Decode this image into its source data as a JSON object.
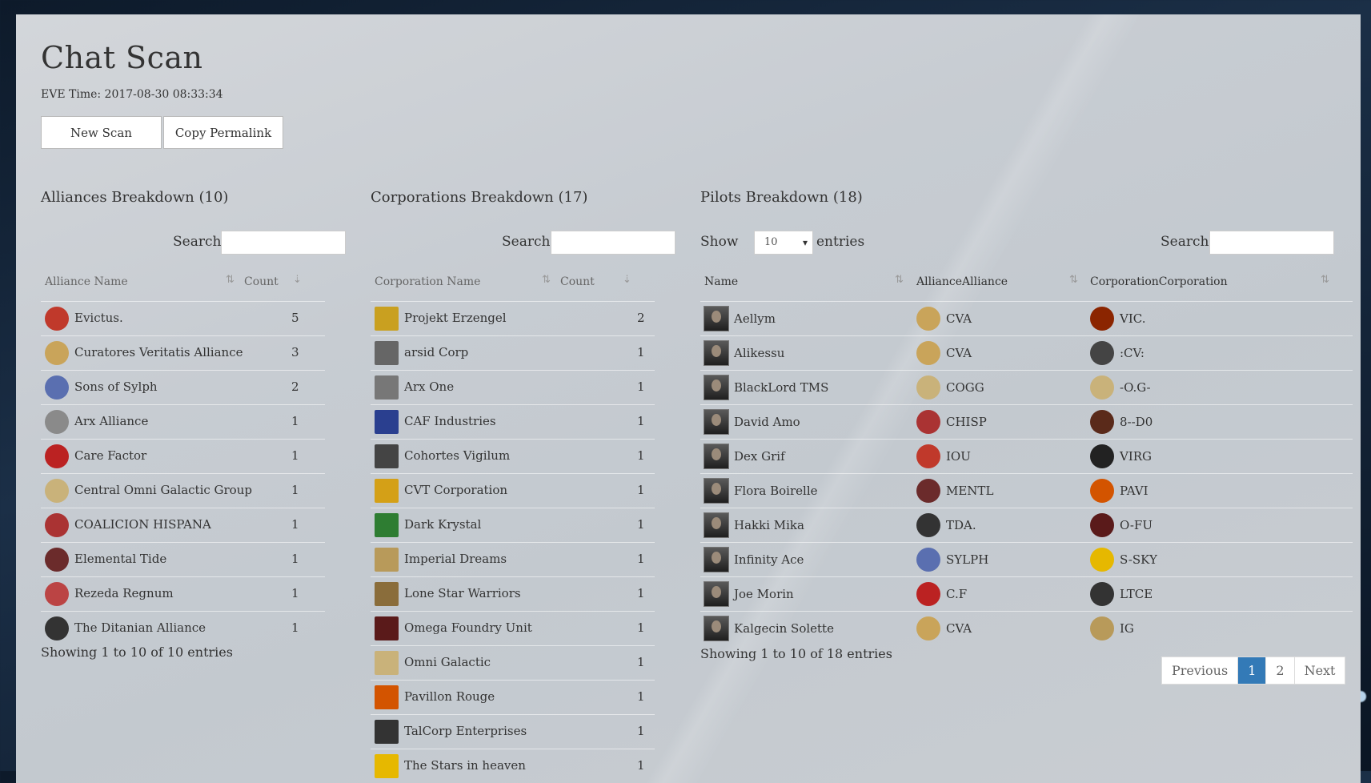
{
  "page": {
    "title": "Chat Scan",
    "eve_time": "EVE Time: 2017-08-30 08:33:34",
    "buttons": {
      "new_scan": "New Scan",
      "copy_permalink": "Copy Permalink"
    }
  },
  "alliances": {
    "title": "Alliances Breakdown (10)",
    "search_label": "Search:",
    "col_name": "Alliance Name",
    "col_count": "Count",
    "rows": [
      {
        "name": "Evictus.",
        "count": "5",
        "icon": "evictus-logo",
        "color": "#c0392b"
      },
      {
        "name": "Curatores Veritatis Alliance",
        "count": "3",
        "icon": "cva-logo",
        "color": "#c9a45a"
      },
      {
        "name": "Sons of Sylph",
        "count": "2",
        "icon": "sylph-logo",
        "color": "#5a6fb0"
      },
      {
        "name": "Arx Alliance",
        "count": "1",
        "icon": "arx-logo",
        "color": "#8a8a8a"
      },
      {
        "name": "Care Factor",
        "count": "1",
        "icon": "care-factor-logo",
        "color": "#b22"
      },
      {
        "name": "Central Omni Galactic Group",
        "count": "1",
        "icon": "cogg-logo",
        "color": "#c9b27a"
      },
      {
        "name": "COALICION HISPANA",
        "count": "1",
        "icon": "chisp-logo",
        "color": "#a33"
      },
      {
        "name": "Elemental Tide",
        "count": "1",
        "icon": "elemental-tide-logo",
        "color": "#6b2b2b"
      },
      {
        "name": "Rezeda Regnum",
        "count": "1",
        "icon": "rezeda-logo",
        "color": "#b44"
      },
      {
        "name": "The Ditanian Alliance",
        "count": "1",
        "icon": "tda-logo",
        "color": "#333"
      }
    ],
    "footer": "Showing 1 to 10 of 10 entries"
  },
  "corporations": {
    "title": "Corporations Breakdown (17)",
    "search_label": "Search:",
    "col_name": "Corporation Name",
    "col_count": "Count",
    "rows": [
      {
        "name": "Projekt Erzengel",
        "count": "2",
        "icon": "erzengel-logo",
        "color": "#c9a020"
      },
      {
        "name": "arsid Corp",
        "count": "1",
        "icon": "arsid-logo",
        "color": "#666"
      },
      {
        "name": "Arx One",
        "count": "1",
        "icon": "arx-one-logo",
        "color": "#777"
      },
      {
        "name": "CAF Industries",
        "count": "1",
        "icon": "caf-logo",
        "color": "#2a3f8f"
      },
      {
        "name": "Cohortes Vigilum",
        "count": "1",
        "icon": "cohortes-logo",
        "color": "#444"
      },
      {
        "name": "CVT Corporation",
        "count": "1",
        "icon": "cvt-logo",
        "color": "#d4a017"
      },
      {
        "name": "Dark Krystal",
        "count": "1",
        "icon": "dark-krystal-logo",
        "color": "#2e7d32"
      },
      {
        "name": "Imperial Dreams",
        "count": "1",
        "icon": "imperial-dreams-logo",
        "color": "#b89a5a"
      },
      {
        "name": "Lone Star Warriors",
        "count": "1",
        "icon": "lone-star-logo",
        "color": "#8a6d3b"
      },
      {
        "name": "Omega Foundry Unit",
        "count": "1",
        "icon": "omega-logo",
        "color": "#5a1a1a"
      },
      {
        "name": "Omni Galactic",
        "count": "1",
        "icon": "omni-galactic-logo",
        "color": "#c9b27a"
      },
      {
        "name": "Pavillon Rouge",
        "count": "1",
        "icon": "pavillon-logo",
        "color": "#d35400"
      },
      {
        "name": "TalCorp Enterprises",
        "count": "1",
        "icon": "talcorp-logo",
        "color": "#333"
      },
      {
        "name": "The Stars in heaven",
        "count": "1",
        "icon": "stars-logo",
        "color": "#e6b800"
      }
    ]
  },
  "pilots": {
    "title": "Pilots Breakdown (18)",
    "show_label": "Show",
    "entries_value": "10",
    "entries_label": "entries",
    "search_label": "Search:",
    "col_name": "Name",
    "col_alliance": "AllianceAlliance",
    "col_corp": "CorporationCorporation",
    "rows": [
      {
        "name": "Aellym",
        "alliance": "CVA",
        "corp": "VIC.",
        "a_color": "#c9a45a",
        "c_color": "#8b2500"
      },
      {
        "name": "Alikessu",
        "alliance": "CVA",
        "corp": ":CV:",
        "a_color": "#c9a45a",
        "c_color": "#444"
      },
      {
        "name": "BlackLord TMS",
        "alliance": "COGG",
        "corp": "-O.G-",
        "a_color": "#c9b27a",
        "c_color": "#c9b27a"
      },
      {
        "name": "David Amo",
        "alliance": "CHISP",
        "corp": "8--D0",
        "a_color": "#a33",
        "c_color": "#5a2a1a"
      },
      {
        "name": "Dex Grif",
        "alliance": "IOU",
        "corp": "VIRG",
        "a_color": "#c0392b",
        "c_color": "#222"
      },
      {
        "name": "Flora Boirelle",
        "alliance": "MENTL",
        "corp": "PAVI",
        "a_color": "#6b2b2b",
        "c_color": "#d35400"
      },
      {
        "name": "Hakki Mika",
        "alliance": "TDA.",
        "corp": "O-FU",
        "a_color": "#333",
        "c_color": "#5a1a1a"
      },
      {
        "name": "Infinity Ace",
        "alliance": "SYLPH",
        "corp": "S-SKY",
        "a_color": "#5a6fb0",
        "c_color": "#e6b800"
      },
      {
        "name": "Joe Morin",
        "alliance": "C.F",
        "corp": "LTCE",
        "a_color": "#b22",
        "c_color": "#333"
      },
      {
        "name": "Kalgecin Solette",
        "alliance": "CVA",
        "corp": "IG",
        "a_color": "#c9a45a",
        "c_color": "#b89a5a"
      }
    ],
    "footer": "Showing 1 to 10 of 18 entries",
    "pager": {
      "prev": "Previous",
      "p1": "1",
      "p2": "2",
      "next": "Next"
    }
  }
}
